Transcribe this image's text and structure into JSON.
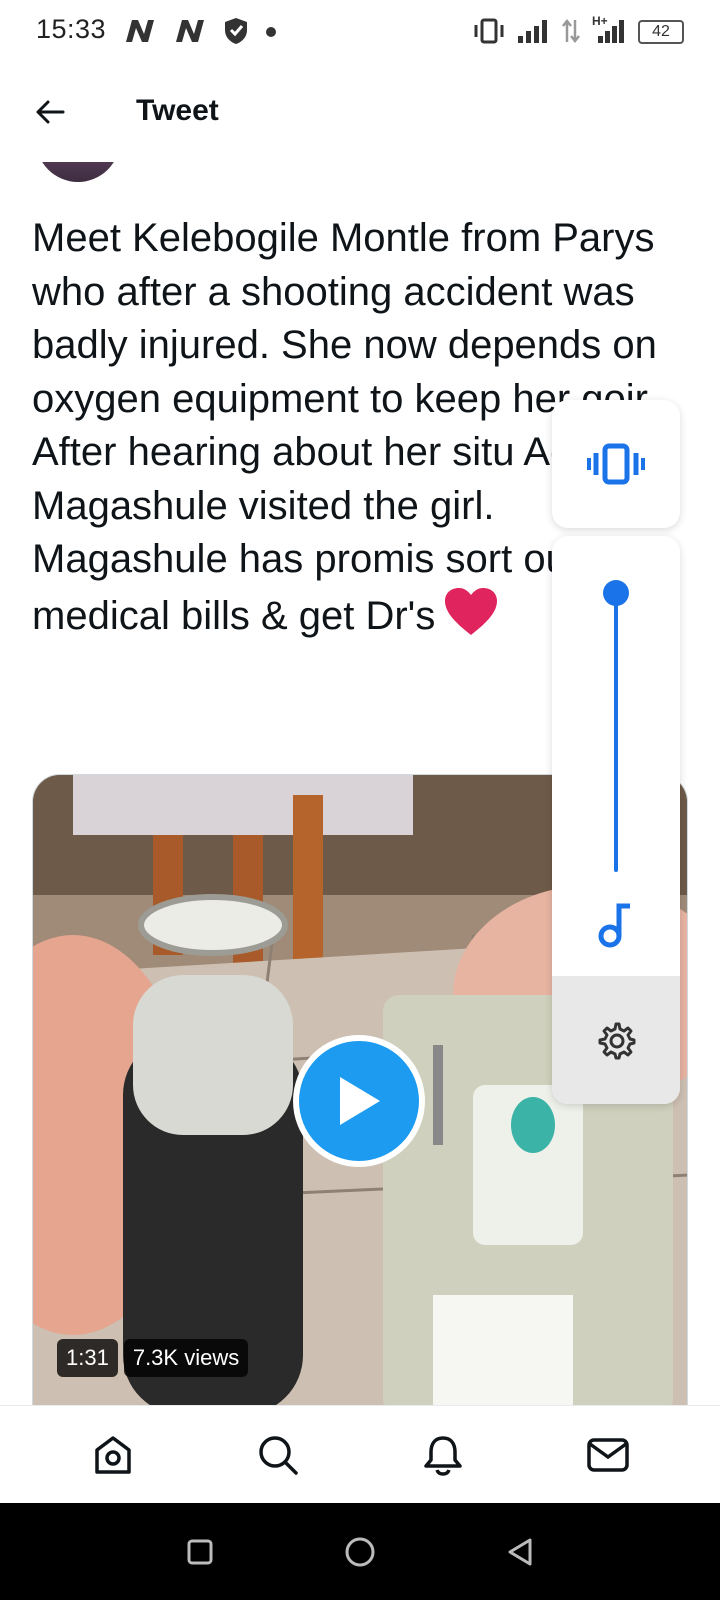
{
  "status_bar": {
    "time": "15:33",
    "left_icons": [
      "netflix-icon",
      "netflix-icon",
      "shield-icon",
      "dot-icon"
    ],
    "right_icons": [
      "vibrate-icon",
      "signal-icon",
      "data-arrows-icon",
      "signal-hplus-icon",
      "battery-icon"
    ],
    "network_label": "H+",
    "battery": "42"
  },
  "header": {
    "title": "Tweet"
  },
  "tweet": {
    "text": "Meet Kelebogile Montle from Parys who after a shooting accident was badly injured. She now depends on oxygen equipment to keep her goir After hearing about her situ Ace Magashule visited the girl. Magashule has promis sort out medical bills & get Dr's"
  },
  "media": {
    "duration": "1:31",
    "views": "7.3K views"
  },
  "volume_panel": {
    "level": 1.0,
    "accent_color": "#1a73e8"
  },
  "bottom_nav": {
    "items": [
      "home-icon",
      "search-icon",
      "notifications-icon",
      "messages-icon"
    ]
  },
  "system_nav": {
    "items": [
      "recents-icon",
      "home-circle-icon",
      "back-triangle-icon"
    ]
  },
  "colors": {
    "twitter_blue": "#1d9bf0",
    "heart_red": "#e0245e"
  }
}
